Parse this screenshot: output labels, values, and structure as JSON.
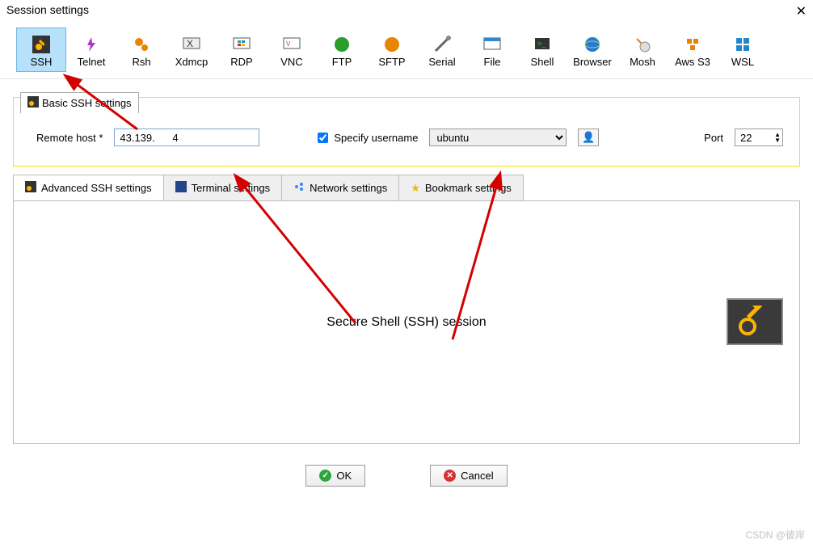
{
  "window": {
    "title": "Session settings"
  },
  "sessions": [
    {
      "id": "ssh",
      "label": "SSH",
      "selected": true
    },
    {
      "id": "telnet",
      "label": "Telnet"
    },
    {
      "id": "rsh",
      "label": "Rsh"
    },
    {
      "id": "xdmcp",
      "label": "Xdmcp"
    },
    {
      "id": "rdp",
      "label": "RDP"
    },
    {
      "id": "vnc",
      "label": "VNC"
    },
    {
      "id": "ftp",
      "label": "FTP"
    },
    {
      "id": "sftp",
      "label": "SFTP"
    },
    {
      "id": "serial",
      "label": "Serial"
    },
    {
      "id": "file",
      "label": "File"
    },
    {
      "id": "shell",
      "label": "Shell"
    },
    {
      "id": "browser",
      "label": "Browser"
    },
    {
      "id": "mosh",
      "label": "Mosh"
    },
    {
      "id": "awss3",
      "label": "Aws S3"
    },
    {
      "id": "wsl",
      "label": "WSL"
    }
  ],
  "basic": {
    "tab_label": "Basic SSH settings",
    "remote_host_label": "Remote host *",
    "remote_host_value": "43.139.      4",
    "specify_username_label": "Specify username",
    "specify_username_checked": true,
    "username_value": "ubuntu",
    "port_label": "Port",
    "port_value": "22"
  },
  "subtabs": {
    "advanced": "Advanced SSH settings",
    "terminal": "Terminal settings",
    "network": "Network settings",
    "bookmark": "Bookmark settings"
  },
  "content": {
    "title": "Secure Shell (SSH) session"
  },
  "buttons": {
    "ok": "OK",
    "cancel": "Cancel"
  },
  "watermark": "CSDN @彼岸"
}
